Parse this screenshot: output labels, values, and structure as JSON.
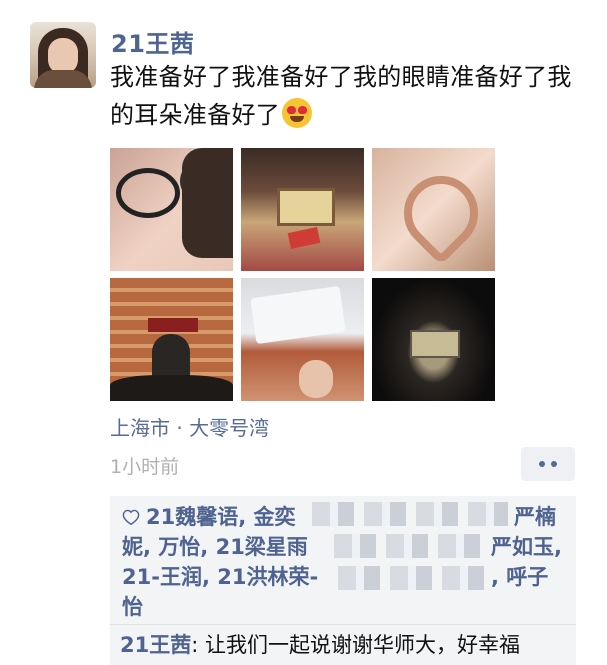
{
  "post": {
    "author": "21王茜",
    "text": "我准备好了我准备好了我的眼睛准备好了我的耳朵准备好了",
    "emoji": "smiling-face-with-heart-eyes",
    "photos": [
      {
        "name": "photo-1",
        "description": "selfie"
      },
      {
        "name": "photo-2",
        "description": "concert hall"
      },
      {
        "name": "photo-3",
        "description": "heart hands"
      },
      {
        "name": "photo-4",
        "description": "speaker on stage"
      },
      {
        "name": "photo-5",
        "description": "program and selfie"
      },
      {
        "name": "photo-6",
        "description": "dark stage view"
      }
    ],
    "location": "上海市 · 大零号湾",
    "time": "1小时前"
  },
  "likes": {
    "line1": "21魏馨语, 金奕",
    "line1_end": "严楠",
    "line2": "妮, 万怡, 21梁星雨",
    "line2_end": "严如玉,",
    "line3": "21-王润, 21洪林荣-",
    "line3_end": ", 呼子",
    "line4": "怡"
  },
  "comment": {
    "author": "21王茜",
    "text": "让我们一起说谢谢华师大，好幸福"
  },
  "colors": {
    "name_blue": "#4d6590",
    "time_gray": "#b0b0b0",
    "panel_bg": "#f3f4f6"
  }
}
